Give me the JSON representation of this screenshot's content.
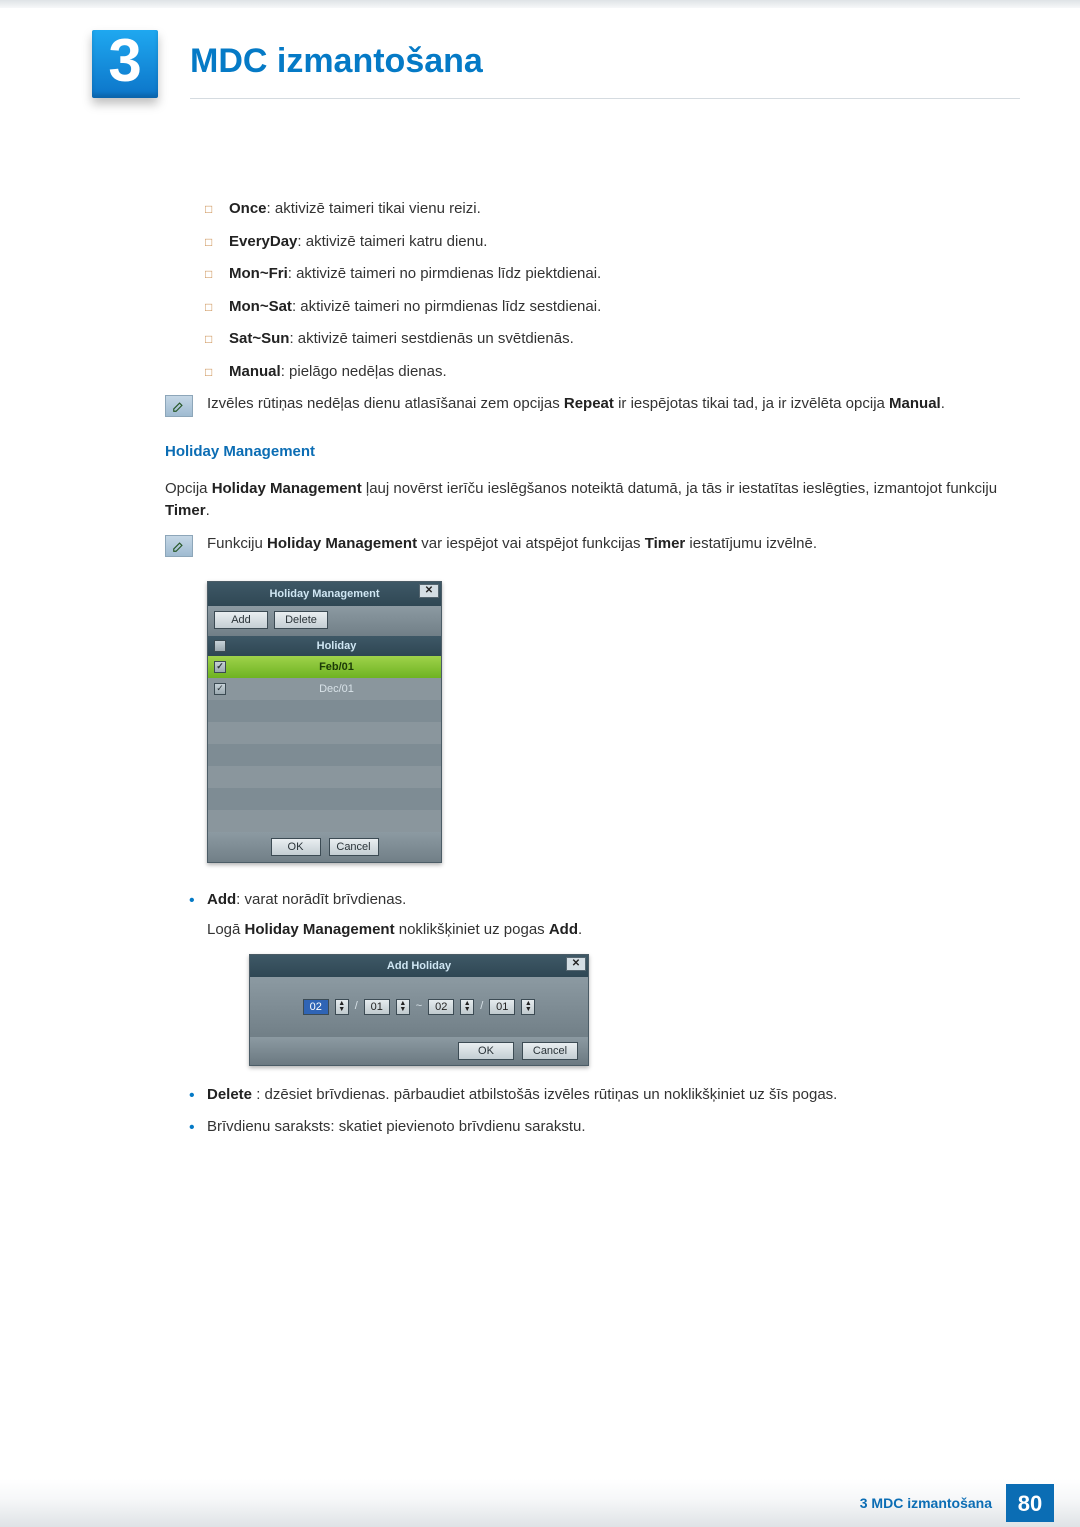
{
  "chapter": {
    "number": "3",
    "title": "MDC izmantošana"
  },
  "repeat_options": [
    {
      "term": "Once",
      "desc": ": aktivizē taimeri tikai vienu reizi."
    },
    {
      "term": "EveryDay",
      "desc": ": aktivizē taimeri katru dienu."
    },
    {
      "term": "Mon~Fri",
      "desc": ": aktivizē taimeri no pirmdienas līdz piektdienai."
    },
    {
      "term": "Mon~Sat",
      "desc": ": aktivizē taimeri no pirmdienas līdz sestdienai."
    },
    {
      "term": "Sat~Sun",
      "desc": ": aktivizē taimeri sestdienās un svētdienās."
    },
    {
      "term": "Manual",
      "desc": ": pielāgo nedēļas dienas."
    }
  ],
  "note_repeat": {
    "pre": "Izvēles rūtiņas nedēļas dienu atlasīšanai zem opcijas ",
    "b1": "Repeat",
    "mid": " ir iespējotas tikai tad, ja ir izvēlēta opcija ",
    "b2": "Manual",
    "post": "."
  },
  "section_heading": "Holiday Management",
  "holiday_para": {
    "pre": "Opcija ",
    "b1": "Holiday Management",
    "mid": " ļauj novērst ierīču ieslēgšanos noteiktā datumā, ja tās ir iestatītas ieslēgties, izmantojot funkciju ",
    "b2": "Timer",
    "post": "."
  },
  "note_holiday": {
    "pre": "Funkciju ",
    "b1": "Holiday Management",
    "mid": " var iespējot vai atspējot funkcijas ",
    "b2": "Timer",
    "post": " iestatījumu izvēlnē."
  },
  "dlg1": {
    "title": "Holiday Management",
    "add": "Add",
    "delete": "Delete",
    "col_header": "Holiday",
    "rows": [
      "Feb/01",
      "Dec/01"
    ],
    "ok": "OK",
    "cancel": "Cancel"
  },
  "bullets": {
    "add": {
      "term": "Add",
      "desc": ": varat norādīt brīvdienas."
    },
    "add_line": {
      "pre": "Logā ",
      "b1": "Holiday Management",
      "mid": " noklikšķiniet uz pogas ",
      "b2": "Add",
      "post": "."
    },
    "delete": {
      "term": "Delete",
      "desc": " : dzēsiet brīvdienas. pārbaudiet atbilstošās izvēles rūtiņas un noklikšķiniet uz šīs pogas."
    },
    "list": "Brīvdienu saraksts: skatiet pievienoto brīvdienu sarakstu."
  },
  "dlg2": {
    "title": "Add Holiday",
    "f1": "02",
    "f2": "01",
    "tilde": "~",
    "f3": "02",
    "f4": "01",
    "ok": "OK",
    "cancel": "Cancel"
  },
  "footer": {
    "text": "3 MDC izmantošana",
    "page": "80"
  }
}
